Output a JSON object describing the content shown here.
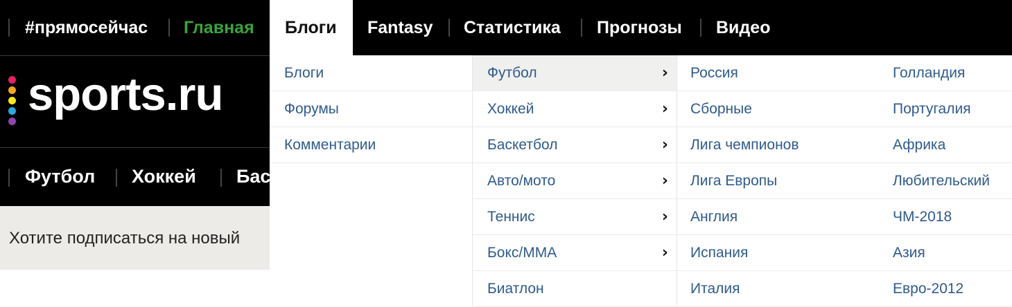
{
  "topnav": {
    "items": [
      {
        "label": "#прямосейчас",
        "color": "#ffffff"
      },
      {
        "label": "Главная",
        "color": "#3aa33c"
      },
      {
        "label": "Блоги",
        "color": "#111111",
        "active": true
      },
      {
        "label": "Fantasy",
        "color": "#ffffff"
      },
      {
        "label": "Статистика",
        "color": "#ffffff"
      },
      {
        "label": "Прогнозы",
        "color": "#ffffff"
      },
      {
        "label": "Видео",
        "color": "#ffffff"
      }
    ]
  },
  "logo": {
    "text": "sports.ru",
    "dot_colors": [
      "#e0245e",
      "#f5a623",
      "#f8e71c",
      "#2aa9e0",
      "#8e44ad"
    ]
  },
  "subnav": {
    "items": [
      "Футбол",
      "Хоккей",
      "Бас"
    ]
  },
  "subscribe_text": "Хотите подписаться на новый",
  "menu": {
    "col1": [
      "Блоги",
      "Форумы",
      "Комментарии"
    ],
    "col2": [
      "Футбол",
      "Хоккей",
      "Баскетбол",
      "Авто/мото",
      "Теннис",
      "Бокс/ММА",
      "Биатлон"
    ],
    "col2_chevron_icon": "chevron-right-icon",
    "col3": [
      "Россия",
      "Сборные",
      "Лига чемпионов",
      "Лига Европы",
      "Англия",
      "Испания",
      "Италия"
    ],
    "col4": [
      "Голландия",
      "Португалия",
      "Африка",
      "Любительский",
      "ЧМ-2018",
      "Азия",
      "Евро-2012"
    ]
  }
}
